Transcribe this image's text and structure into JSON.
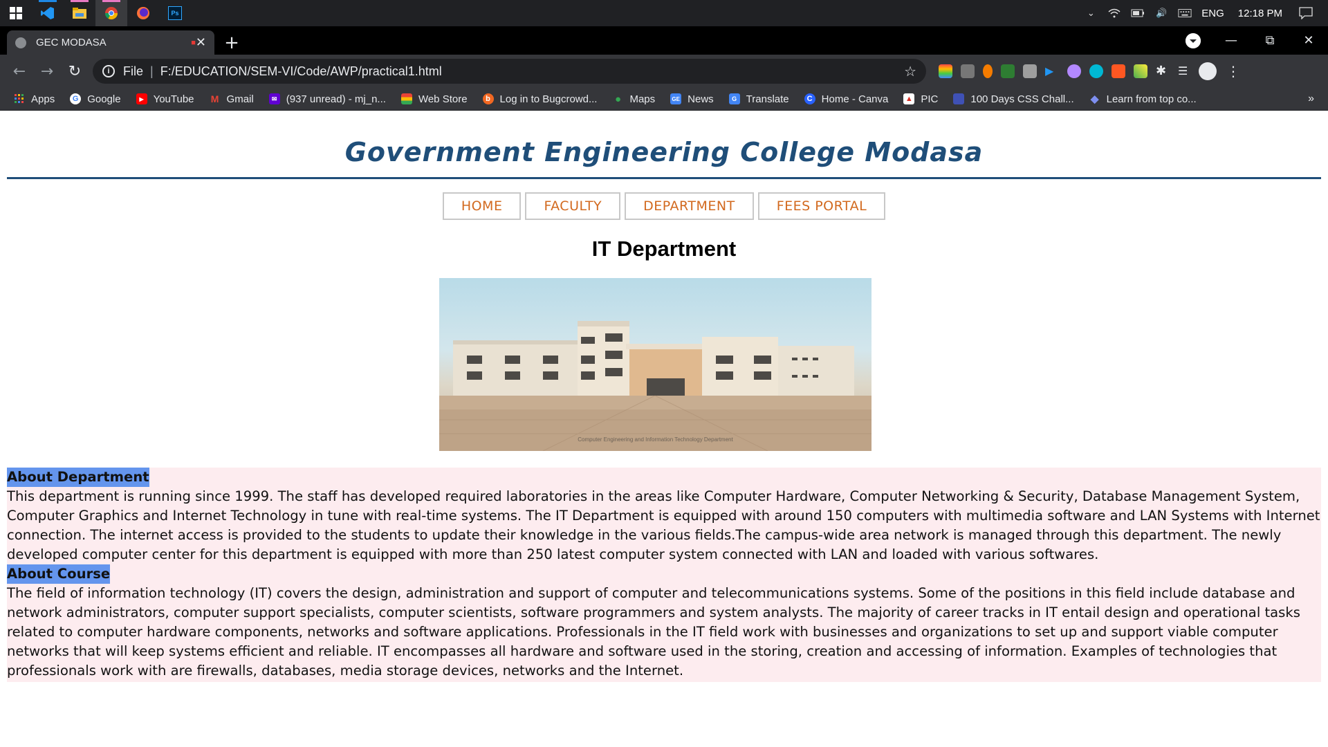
{
  "taskbar": {
    "apps": [
      {
        "icon": "windows-start-icon"
      },
      {
        "icon": "vscode-icon"
      },
      {
        "icon": "file-explorer-icon"
      },
      {
        "icon": "chrome-icon",
        "active": true
      },
      {
        "icon": "firefox-icon"
      },
      {
        "icon": "photoshop-icon",
        "label": "Ps"
      }
    ],
    "language": "ENG",
    "time": "12:18 PM"
  },
  "browser": {
    "tab_title": "GEC MODASA",
    "address": {
      "scheme_label": "File",
      "url": "F:/EDUCATION/SEM-VI/Code/AWP/practical1.html"
    },
    "bookmarks": [
      {
        "label": "Apps",
        "icon": "apps-grid-icon",
        "color": "#e44"
      },
      {
        "label": "Google",
        "icon": "google-icon",
        "color": "#4285f4"
      },
      {
        "label": "YouTube",
        "icon": "youtube-icon",
        "color": "#ff0000"
      },
      {
        "label": "Gmail",
        "icon": "gmail-icon",
        "color": "#ea4335"
      },
      {
        "label": "(937 unread) - mj_n...",
        "icon": "yahoo-mail-icon",
        "color": "#6001d2"
      },
      {
        "label": "Web Store",
        "icon": "web-store-icon",
        "color": "#34a853"
      },
      {
        "label": "Log in to Bugcrowd...",
        "icon": "bugcrowd-icon",
        "color": "#f26822"
      },
      {
        "label": "Maps",
        "icon": "maps-icon",
        "color": "#34a853"
      },
      {
        "label": "News",
        "icon": "news-icon",
        "color": "#4285f4"
      },
      {
        "label": "Translate",
        "icon": "translate-icon",
        "color": "#4285f4"
      },
      {
        "label": "Home - Canva",
        "icon": "canva-icon",
        "color": "#00c4cc"
      },
      {
        "label": "PIC",
        "icon": "pic-icon",
        "color": "#d93025"
      },
      {
        "label": "100 Days CSS Chall...",
        "icon": "css-challenge-icon",
        "color": "#3f51b5"
      },
      {
        "label": "Learn from top co...",
        "icon": "diamond-icon",
        "color": "#5b6ee1"
      }
    ]
  },
  "site": {
    "title": "Government Engineering College Modasa",
    "menu": [
      "HOME",
      "FACULTY",
      "DEPARTMENT",
      "FEES PORTAL"
    ],
    "heading": "IT Department",
    "image_caption": "Computer Engineering and Information Technology Department",
    "sections": [
      {
        "title": "About Department",
        "body": "This department is running since 1999. The staff has developed required laboratories in the areas like Computer Hardware, Computer Networking & Security, Database Management System, Computer Graphics and Internet Technology in tune with real-time systems. The IT Department is equipped with around 150 computers with multimedia software and LAN Systems with Internet connection. The internet access is provided to the students to update their knowledge in the various fields.The campus-wide area network is managed through this department. The newly developed computer center for this department is equipped with more than 250 latest computer system connected with LAN and loaded with various softwares."
      },
      {
        "title": "About Course",
        "body": "The field of information technology (IT) covers the design, administration and support of computer and telecommunications systems. Some of the positions in this field include database and network administrators, computer support specialists, computer scientists, software programmers and system analysts. The majority of career tracks in IT entail design and operational tasks related to computer hardware components, networks and software applications. Professionals in the IT field work with businesses and organizations to set up and support viable computer networks that will keep systems efficient and reliable. IT encompasses all hardware and software used in the storing, creation and accessing of information. Examples of technologies that professionals work with are firewalls, databases, media storage devices, networks and the Internet."
      }
    ]
  },
  "colors": {
    "title": "#1f4e79",
    "menu_text": "#d2691e",
    "section_highlight": "#6495ed",
    "content_background": "#fdecef"
  }
}
